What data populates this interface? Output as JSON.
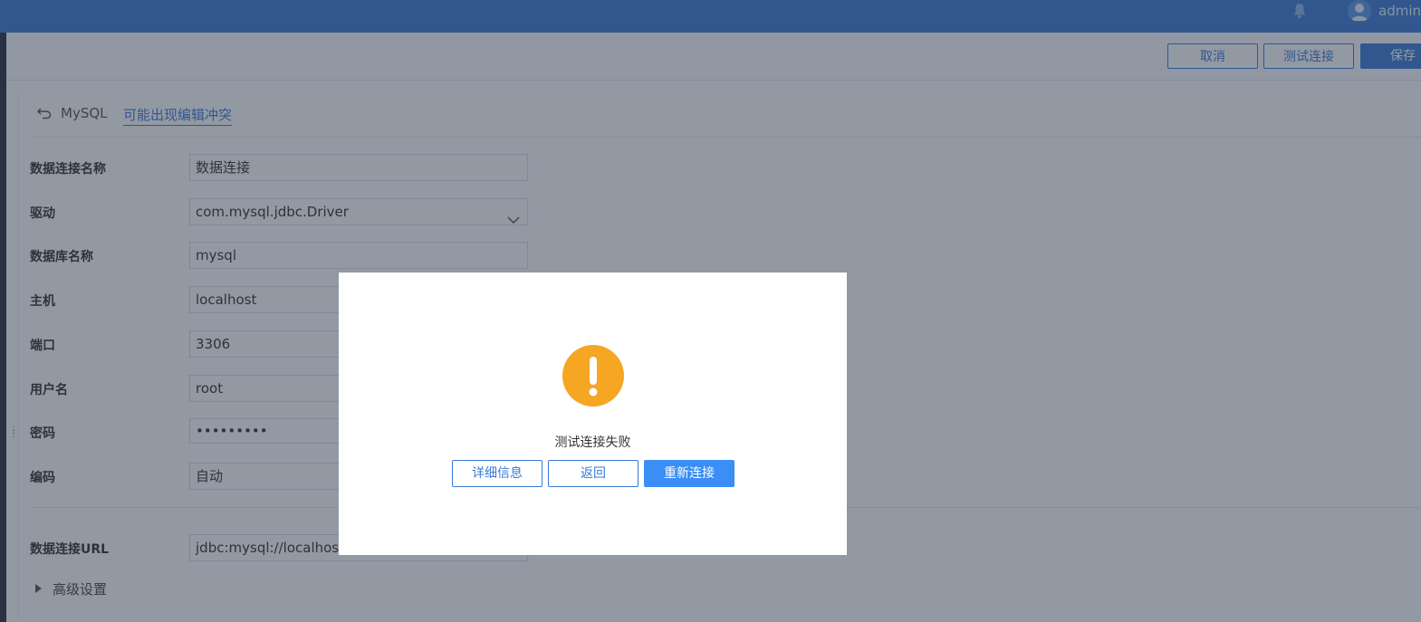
{
  "topbar": {
    "icons": [
      "bell-icon",
      "user-avatar-icon"
    ],
    "username": "admin"
  },
  "toolbar": {
    "cancel_label": "取消",
    "test_label": "测试连接",
    "save_label": "保存"
  },
  "breadcrumb": {
    "back_icon": "undo-arrow-icon",
    "db_type": "MySQL",
    "warning": "可能出现编辑冲突"
  },
  "form": {
    "fields": [
      {
        "label": "数据连接名称",
        "value": "数据连接"
      },
      {
        "label": "驱动",
        "value": "com.mysql.jdbc.Driver"
      },
      {
        "label": "数据库名称",
        "value": "mysql"
      },
      {
        "label": "主机",
        "value": "localhost"
      },
      {
        "label": "端口",
        "value": "3306"
      },
      {
        "label": "用户名",
        "value": "root"
      },
      {
        "label": "密码",
        "value": "•••••••••"
      },
      {
        "label": "编码",
        "value": "自动"
      }
    ],
    "url_label": "数据连接URL",
    "url_value": "jdbc:mysql://localhost:",
    "advanced_label": "高级设置"
  },
  "dialog": {
    "icon": "exclamation-circle-icon",
    "message": "测试连接失败",
    "details_label": "详细信息",
    "back_label": "返回",
    "reconnect_label": "重新连接"
  },
  "colors": {
    "accent": "#3a7bd5",
    "warning": "#f5a623",
    "overlay": "rgba(40,52,72,0.5)"
  }
}
